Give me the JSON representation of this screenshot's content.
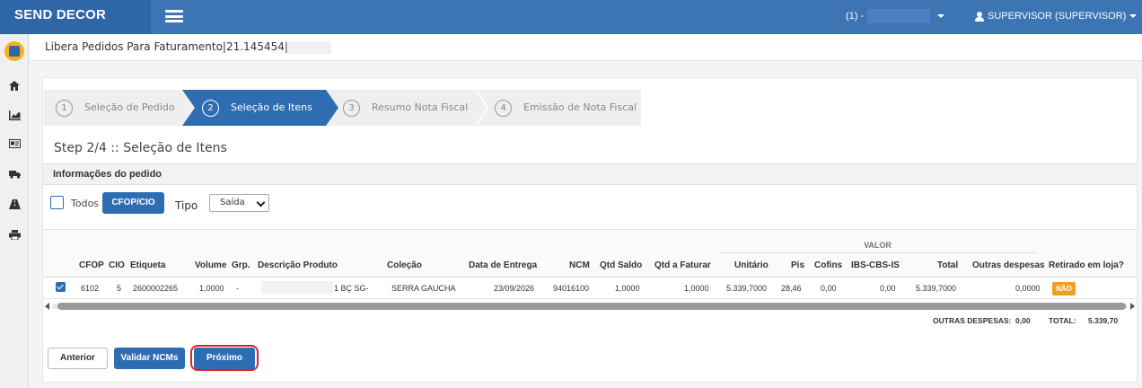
{
  "app": {
    "brand": "SEND DECOR",
    "company_prefix": "(1) -",
    "user_label": "SUPERVISOR (SUPERVISOR)"
  },
  "page": {
    "title": "Libera Pedidos Para Faturamento|21.145454|"
  },
  "steps": [
    {
      "num": "1",
      "label": "Seleção de Pedido"
    },
    {
      "num": "2",
      "label": "Seleção de Itens"
    },
    {
      "num": "3",
      "label": "Resumo Nota Fiscal"
    },
    {
      "num": "4",
      "label": "Emissão de Nota Fiscal"
    }
  ],
  "step_heading": "Step 2/4 :: Seleção de Itens",
  "section_title": "Informações do pedido",
  "filters": {
    "todos_label": "Todos",
    "cfop_button": "CFOP/CIO",
    "tipo_label": "Tipo",
    "tipo_value": "Saída"
  },
  "table": {
    "group_header": "VALOR",
    "columns": {
      "cfop": "CFOP",
      "cio": "CIO",
      "etiqueta": "Etiqueta",
      "volume": "Volume",
      "grp": "Grp.",
      "descricao": "Descrição Produto",
      "colecao": "Coleção",
      "data_entrega": "Data de Entrega",
      "ncm": "NCM",
      "qtd_saldo": "Qtd Saldo",
      "qtd_faturar": "Qtd a Faturar",
      "unitario": "Unitário",
      "pis": "Pis",
      "cofins": "Cofins",
      "ibs": "IBS-CBS-IS",
      "total": "Total",
      "outras": "Outras despesas",
      "retirado": "Retirado em loja?"
    },
    "rows": [
      {
        "cfop": "6102",
        "cio": "5",
        "etiqueta": "2600002265",
        "volume": "1,0000",
        "grp": "-",
        "descricao": "1 BÇ SG-",
        "colecao": "SERRA GAUCHA",
        "data_entrega": "23/09/2026",
        "ncm": "94016100",
        "qtd_saldo": "1,0000",
        "qtd_faturar": "1,0000",
        "unitario": "5.339,7000",
        "pis": "28,46",
        "cofins": "0,00",
        "ibs": "0,00",
        "total": "5.339,7000",
        "outras": "0,0000",
        "retirado": "NÃO"
      }
    ]
  },
  "totals": {
    "outras_label": "OUTRAS DESPESAS:",
    "outras_value": "0,00",
    "total_label": "TOTAL:",
    "total_value": "5.339,70"
  },
  "buttons": {
    "anterior": "Anterior",
    "validar": "Validar NCMs",
    "proximo": "Próximo"
  },
  "colors": {
    "primary": "#2f6db3",
    "topbar": "#3c74b4",
    "badge": "#f0a020",
    "highlight_ring": "#d9232a"
  },
  "icons": {
    "sidebar": [
      "home-icon",
      "chart-icon",
      "id-card-icon",
      "truck-icon",
      "road-icon",
      "printer-icon"
    ]
  }
}
